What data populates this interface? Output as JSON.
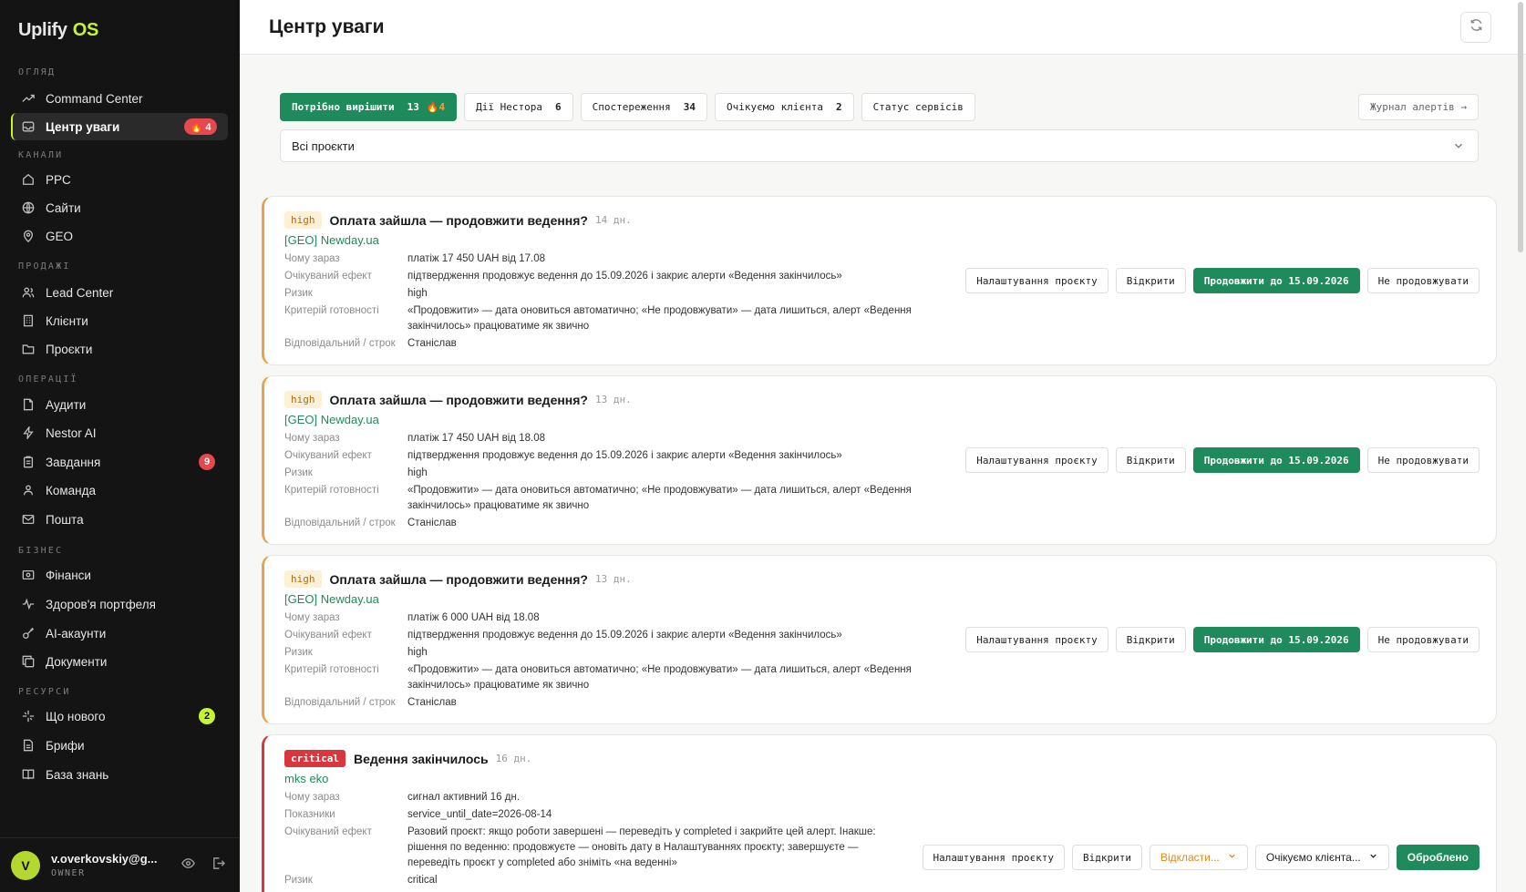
{
  "app": {
    "brand": "Uplify",
    "brand_suffix": "OS"
  },
  "sidebar": {
    "sections": {
      "overview": "ОГЛЯД",
      "channels": "КАНАЛИ",
      "sales": "ПРОДАЖІ",
      "operations": "ОПЕРАЦІЇ",
      "business": "БІЗНЕС",
      "resources": "РЕСУРСИ"
    },
    "items": {
      "command_center": "Command Center",
      "attention_center": "Центр уваги",
      "attention_badge": "🔥 4",
      "ppc": "PPC",
      "sites": "Сайти",
      "geo": "GEO",
      "lead_center": "Lead Center",
      "clients": "Клієнти",
      "projects": "Проєкти",
      "audits": "Аудити",
      "nestor_ai": "Nestor AI",
      "tasks": "Завдання",
      "tasks_badge": "9",
      "team": "Команда",
      "mail": "Пошта",
      "finance": "Фінанси",
      "portfolio_health": "Здоров'я портфеля",
      "ai_accounts": "AI-акаунти",
      "documents": "Документи",
      "whats_new": "Що нового",
      "whats_new_badge": "2",
      "briefs": "Брифи",
      "knowledge_base": "База знань"
    },
    "user": {
      "initial": "V",
      "email": "v.overkovskiy@g...",
      "role": "OWNER"
    }
  },
  "header": {
    "title": "Центр уваги"
  },
  "tabs": [
    {
      "label": "Потрібно вирішити",
      "count": "13",
      "extra": "🔥4"
    },
    {
      "label": "Дії Нестора",
      "count": "6"
    },
    {
      "label": "Спостереження",
      "count": "34"
    },
    {
      "label": "Очікуємо клієнта",
      "count": "2"
    },
    {
      "label": "Статус сервісів",
      "count": ""
    }
  ],
  "journal_label": "Журнал алертів →",
  "project_filter": {
    "value": "Всі проєкти"
  },
  "labels": {
    "why_now": "Чому зараз",
    "expected_effect": "Очікуваний ефект",
    "risk": "Ризик",
    "readiness": "Критерій готовності",
    "responsible": "Відповідальний / строк",
    "metrics": "Показники"
  },
  "buttons": {
    "project_settings": "Налаштування проєкту",
    "open": "Відкрити",
    "extend": "Продовжити до 15.09.2026",
    "dont_extend": "Не продовжувати",
    "postpone": "Відкласти...",
    "awaiting_client": "Очікуємо клієнта...",
    "processed": "Оброблено"
  },
  "alerts": [
    {
      "severity": "high",
      "title": "Оплата зайшла — продовжити ведення?",
      "age": "14 дн.",
      "project": "[GEO] Newday.ua",
      "why_now": "платіж 17 450 UAH від 17.08",
      "effect": "підтвердження продовжує ведення до 15.09.2026 і закриє алерти «Ведення закінчилось»",
      "risk": "high",
      "readiness": "«Продовжити» — дата оновиться автоматично; «Не продовжувати» — дата лишиться, алерт «Ведення закінчилось» працюватиме як звично",
      "responsible": "Станіслав"
    },
    {
      "severity": "high",
      "title": "Оплата зайшла — продовжити ведення?",
      "age": "13 дн.",
      "project": "[GEO] Newday.ua",
      "why_now": "платіж 17 450 UAH від 18.08",
      "effect": "підтвердження продовжує ведення до 15.09.2026 і закриє алерти «Ведення закінчилось»",
      "risk": "high",
      "readiness": "«Продовжити» — дата оновиться автоматично; «Не продовжувати» — дата лишиться, алерт «Ведення закінчилось» працюватиме як звично",
      "responsible": "Станіслав"
    },
    {
      "severity": "high",
      "title": "Оплата зайшла — продовжити ведення?",
      "age": "13 дн.",
      "project": "[GEO] Newday.ua",
      "why_now": "платіж 6 000 UAH від 18.08",
      "effect": "підтвердження продовжує ведення до 15.09.2026 і закриє алерти «Ведення закінчилось»",
      "risk": "high",
      "readiness": "«Продовжити» — дата оновиться автоматично; «Не продовжувати» — дата лишиться, алерт «Ведення закінчилось» працюватиме як звично",
      "responsible": "Станіслав"
    },
    {
      "severity": "critical",
      "title": "Ведення закінчилось",
      "age": "16 дн.",
      "project": "mks eko",
      "why_now": "сигнал активний 16 дн.",
      "metrics": "service_until_date=2026-08-14",
      "effect": "Разовий проєкт: якщо роботи завершені — переведіть у completed і закрийте цей алерт. Інакше: рішення по веденню: продовжуєте — оновіть дату в Налаштуваннях проєкту; завершуєте — переведіть проєкт у completed або зніміть «на веденні»",
      "risk": "critical"
    }
  ],
  "colors": {
    "accent": "#1f8a5c",
    "lime": "#c6f432",
    "critical": "#d9363e",
    "high": "#e6a44e"
  }
}
